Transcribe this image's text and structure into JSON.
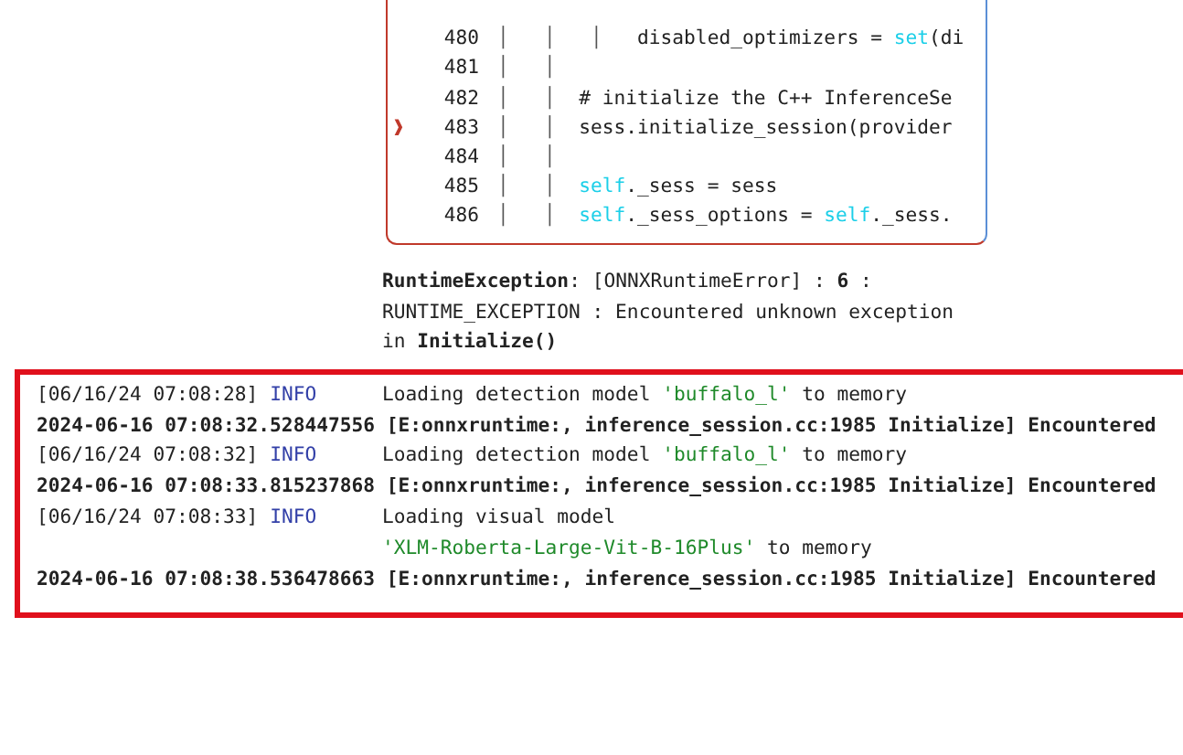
{
  "traceback": {
    "lines": [
      {
        "number": "480",
        "guides": "│   │   │   ",
        "tokens": [
          {
            "text": "disabled_optimizers = ",
            "kind": "plain"
          },
          {
            "text": "set",
            "kind": "builtin"
          },
          {
            "text": "(di",
            "kind": "plain"
          }
        ]
      },
      {
        "number": "481",
        "guides": "│   │"
      },
      {
        "number": "482",
        "guides": "│   │  ",
        "tokens": [
          {
            "text": "# initialize the C++ InferenceSe",
            "kind": "plain"
          }
        ]
      },
      {
        "number": "483",
        "marker": "❱",
        "guides": "│   │  ",
        "tokens": [
          {
            "text": "sess.initialize_session(provider",
            "kind": "plain"
          }
        ]
      },
      {
        "number": "484",
        "guides": "│   │"
      },
      {
        "number": "485",
        "guides": "│   │  ",
        "tokens": [
          {
            "text": "self",
            "kind": "builtin"
          },
          {
            "text": "._sess = sess",
            "kind": "plain"
          }
        ]
      },
      {
        "number": "486",
        "guides": "│   │  ",
        "tokens": [
          {
            "text": "self",
            "kind": "builtin"
          },
          {
            "text": "._sess_options = ",
            "kind": "plain"
          },
          {
            "text": "self",
            "kind": "builtin"
          },
          {
            "text": "._sess.",
            "kind": "plain"
          }
        ]
      }
    ]
  },
  "exception": [
    "**RuntimeException**: [ONNXRuntimeError] : **6** :",
    "RUNTIME_EXCEPTION : Encountered unknown exception",
    "in **Initialize()**"
  ],
  "log": [
    {
      "kind": "info",
      "timestamp": "[06/16/24 07:08:28]",
      "level": "INFO",
      "message": [
        [
          {
            "text": "Loading detection model ",
            "kind": "plain"
          },
          {
            "text": "'buffalo_l'",
            "kind": "string"
          },
          {
            "text": " to memory",
            "kind": "plain"
          }
        ]
      ]
    },
    {
      "kind": "error",
      "text": "2024-06-16 07:08:32.528447556 [E:onnxruntime:, inference_session.cc:1985 Initialize] Encountered"
    },
    {
      "kind": "info",
      "timestamp": "[06/16/24 07:08:32]",
      "level": "INFO",
      "message": [
        [
          {
            "text": "Loading detection model ",
            "kind": "plain"
          },
          {
            "text": "'buffalo_l'",
            "kind": "string"
          },
          {
            "text": " to memory",
            "kind": "plain"
          }
        ]
      ]
    },
    {
      "kind": "error",
      "text": "2024-06-16 07:08:33.815237868 [E:onnxruntime:, inference_session.cc:1985 Initialize] Encountered"
    },
    {
      "kind": "info",
      "timestamp": "[06/16/24 07:08:33]",
      "level": "INFO",
      "message": [
        [
          {
            "text": "Loading visual model",
            "kind": "plain"
          }
        ],
        [
          {
            "text": "'XLM-Roberta-Large-Vit-B-16Plus'",
            "kind": "string"
          },
          {
            "text": " to memory",
            "kind": "plain"
          }
        ]
      ]
    },
    {
      "kind": "error",
      "text": "2024-06-16 07:08:38.536478663 [E:onnxruntime:, inference_session.cc:1985 Initialize] Encountered"
    }
  ]
}
